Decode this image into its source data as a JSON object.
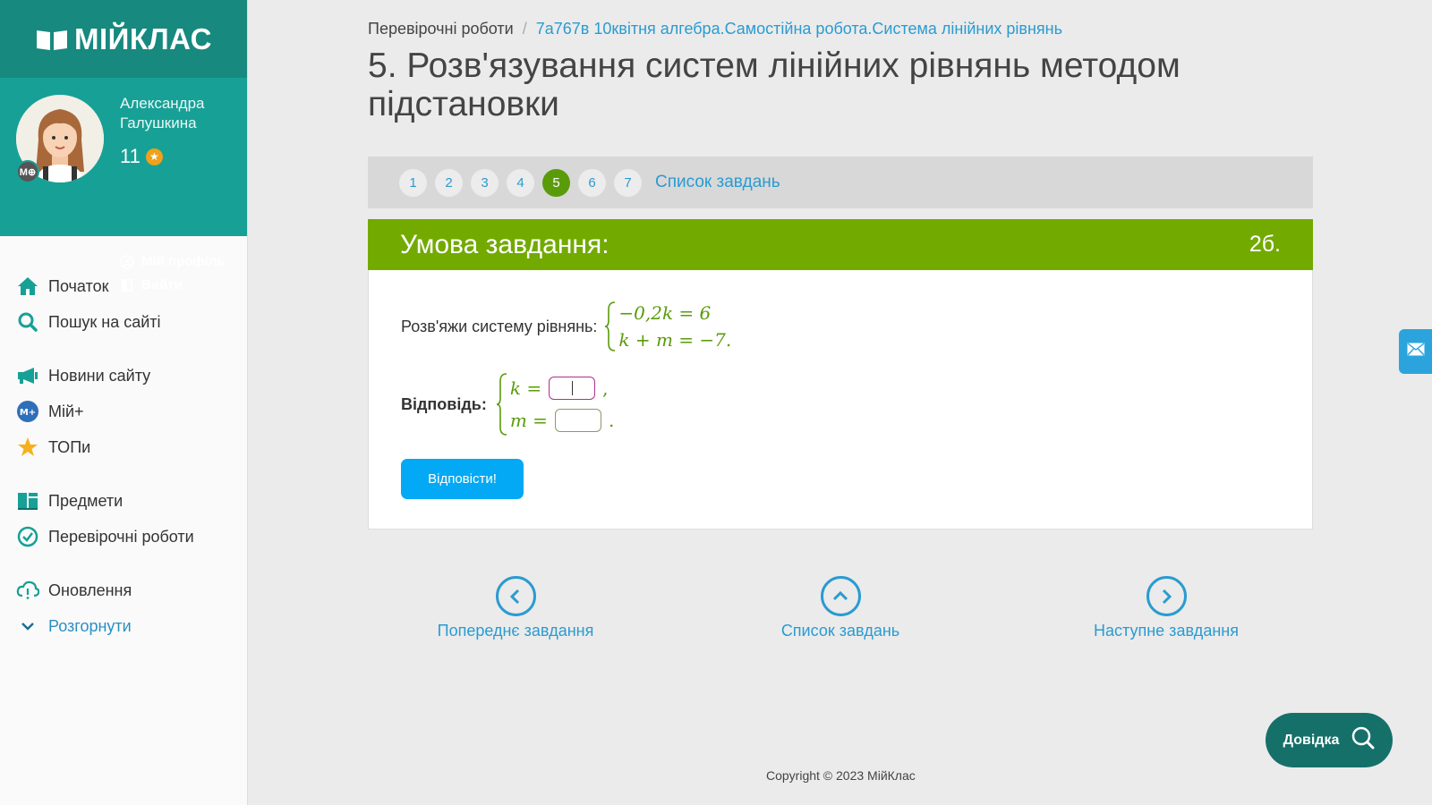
{
  "sidebar": {
    "logo": "МІЙКЛАС",
    "user": {
      "name": "Александра Галушкина",
      "badge": "M⊕",
      "points": "11",
      "profile_link": "Мій профіль",
      "logout_link": "Вийти"
    },
    "menu": {
      "home": "Початок",
      "search": "Пошук на сайті",
      "news": "Новини сайту",
      "my_plus": "Мій+",
      "tops": "ТОПи",
      "subjects": "Предмети",
      "tests": "Перевірочні роботи",
      "updates": "Оновлення",
      "expand": "Розгорнути"
    }
  },
  "breadcrumb": {
    "first": "Перевірочні роботи",
    "separator": "/",
    "second": "7а767в 10квітня алгебра.Самостійна робота.Система лінійних рівнянь"
  },
  "page_title": "5. Розв'язування систем лінійних рівнянь методом підстановки",
  "task_nav": {
    "numbers": [
      "1",
      "2",
      "3",
      "4",
      "5",
      "6",
      "7"
    ],
    "active": "5",
    "list_link": "Список завдань"
  },
  "card": {
    "title": "Умова завдання:",
    "points": "2б.",
    "question_label": "Розв'яжи систему рівнянь:",
    "equation_1": "−0,2k = 6",
    "equation_2": "k + m = −7.",
    "answer_label": "Відповідь:",
    "answer_var_1": "k =",
    "answer_punct_1": ",",
    "answer_var_2": "m =",
    "answer_punct_2": ".",
    "answer_value_1": "",
    "answer_value_2": "",
    "submit_label": "Відповісти!"
  },
  "pager": {
    "prev": "Попереднє завдання",
    "list": "Список завдань",
    "next": "Наступне завдання"
  },
  "help_button": "Довідка",
  "copyright": "Copyright © 2023 МійКлас",
  "colors": {
    "sidebar_teal": "#17a096",
    "logo_teal": "#17897f",
    "card_header_green": "#72aa00",
    "active_task_green": "#5a9b0a",
    "link_blue": "#2a9bd1",
    "submit_blue": "#03a9f4",
    "help_dark_teal": "#15706a"
  },
  "icons": {
    "logo": "book-icon",
    "home": "home-icon",
    "search": "search-icon",
    "news": "megaphone-icon",
    "my_plus": "myplus-icon",
    "tops": "star-icon",
    "subjects": "books-icon",
    "tests": "check-circle-icon",
    "updates": "cloud-icon",
    "expand": "chevron-down-icon",
    "mail": "mail-icon",
    "help": "search-help-icon"
  }
}
